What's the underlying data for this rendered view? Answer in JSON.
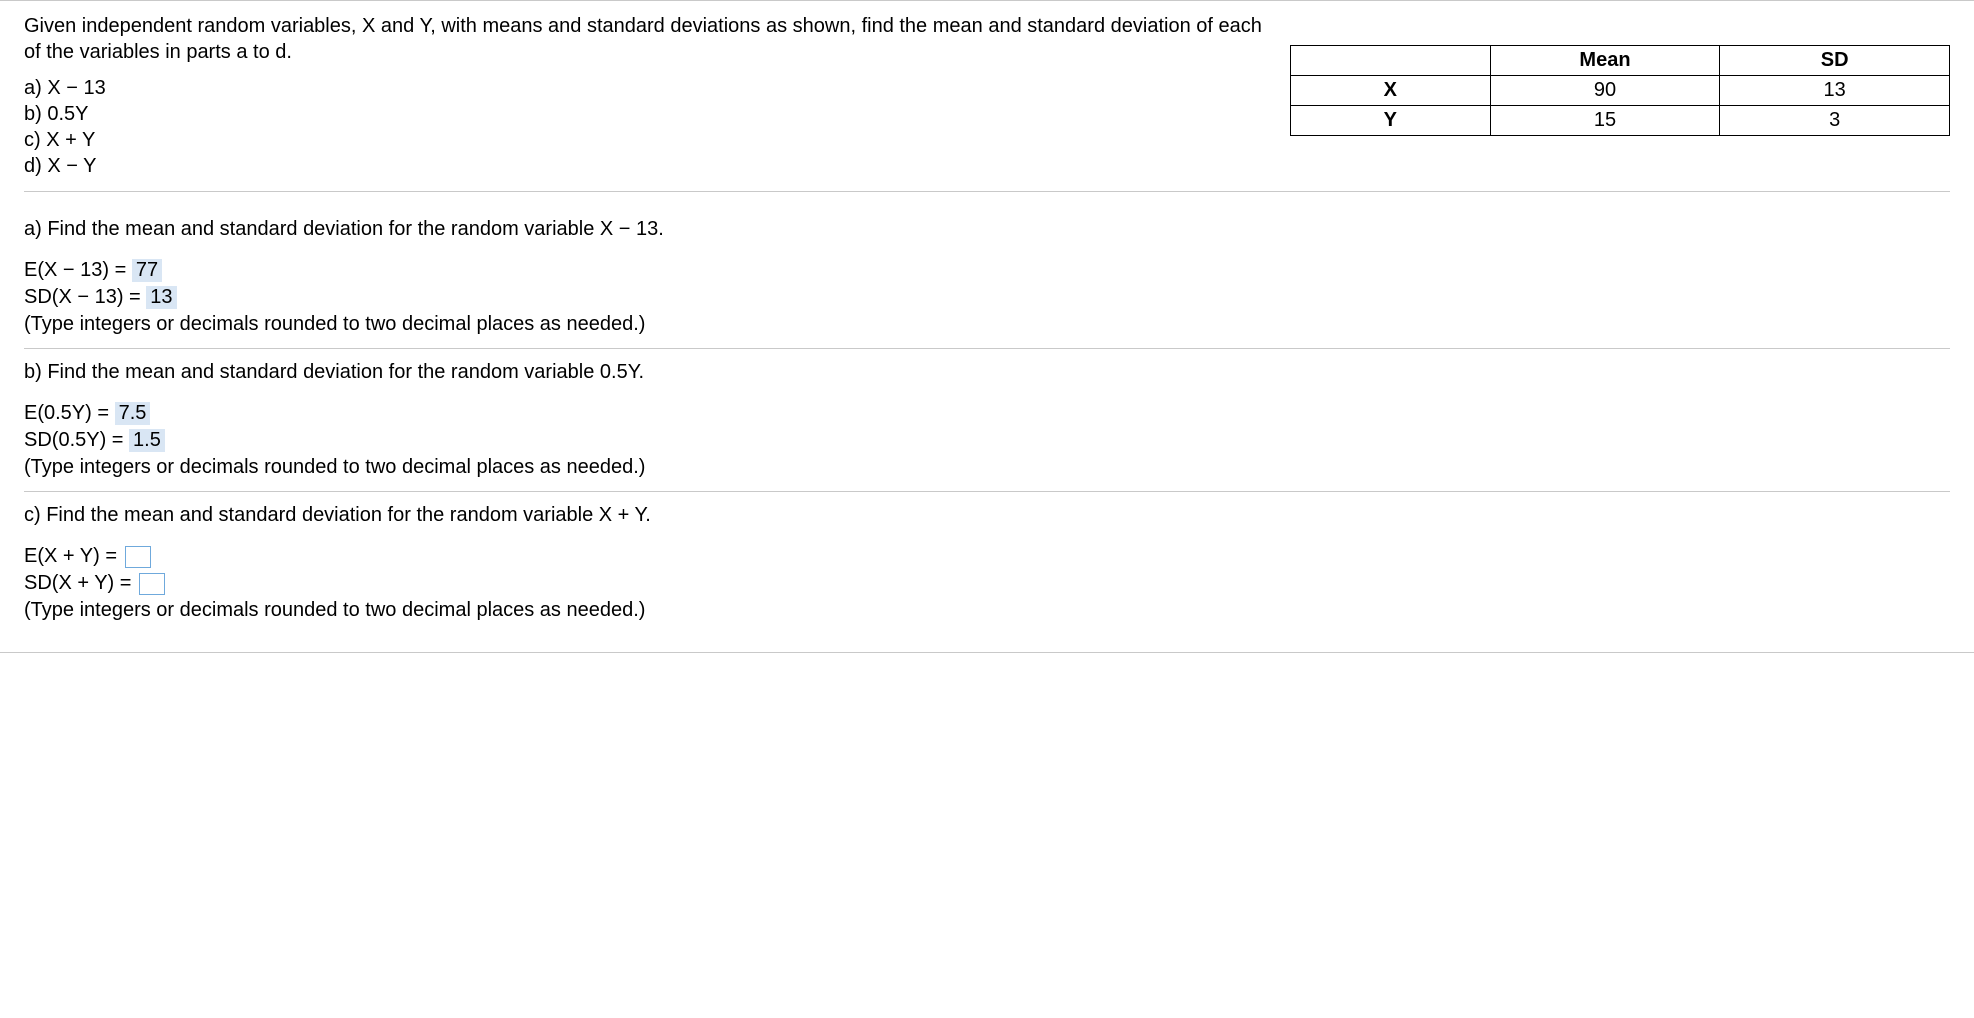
{
  "intro": "Given independent random variables, X and Y, with means and standard deviations as shown, find the mean and standard deviation of each of the variables in parts a to d.",
  "parts": {
    "a": "a) X − 13",
    "b": "b) 0.5Y",
    "c": "c) X + Y",
    "d": "d) X − Y"
  },
  "table": {
    "headers": {
      "var": "",
      "mean": "Mean",
      "sd": "SD"
    },
    "rows": [
      {
        "var": "X",
        "mean": "90",
        "sd": "13"
      },
      {
        "var": "Y",
        "mean": "15",
        "sd": "3"
      }
    ]
  },
  "sections": {
    "a": {
      "prompt": "a) Find the mean and standard deviation for the random variable X − 13.",
      "e_label": "E(X − 13) =",
      "e_value": "77",
      "sd_label": "SD(X − 13) =",
      "sd_value": "13",
      "hint": "(Type integers or decimals rounded to two decimal places as needed.)"
    },
    "b": {
      "prompt": "b) Find the mean and standard deviation for the random variable 0.5Y.",
      "e_label": "E(0.5Y) =",
      "e_value": "7.5",
      "sd_label": "SD(0.5Y) =",
      "sd_value": "1.5",
      "hint": "(Type integers or decimals rounded to two decimal places as needed.)"
    },
    "c": {
      "prompt": "c) Find the mean and standard deviation for the random variable X + Y.",
      "e_label": "E(X + Y) =",
      "sd_label": "SD(X + Y) =",
      "hint": "(Type integers or decimals rounded to two decimal places as needed.)"
    }
  }
}
